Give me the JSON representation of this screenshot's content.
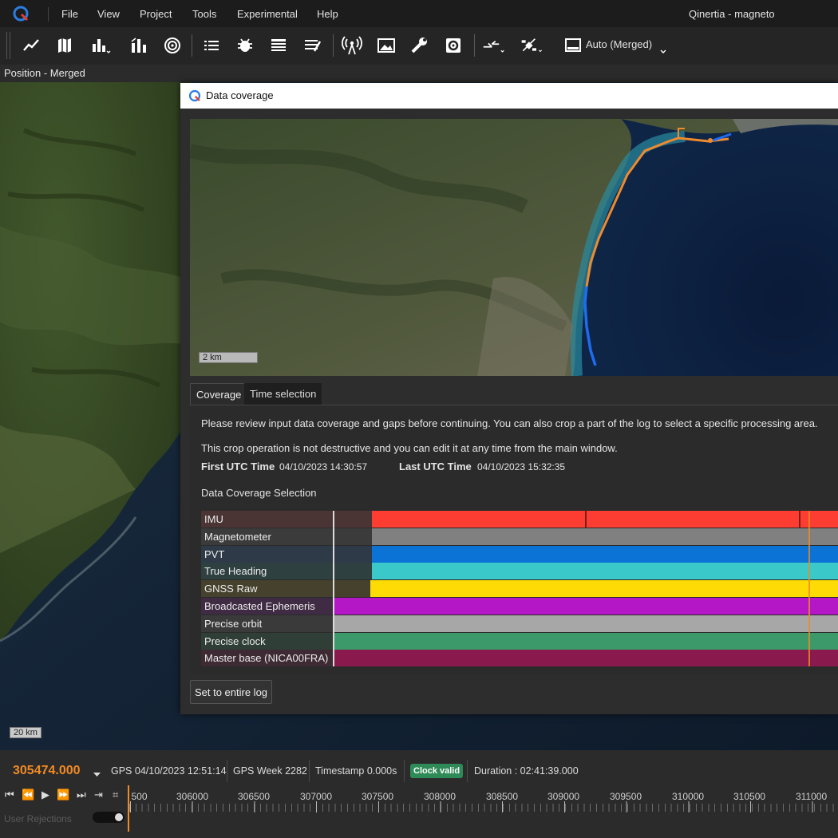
{
  "app": {
    "title": "Qinertia - magneto",
    "menu": [
      "File",
      "View",
      "Project",
      "Tools",
      "Experimental",
      "Help"
    ]
  },
  "toolbar": {
    "icons": [
      "line-chart-icon",
      "map-icon",
      "bar-chart-icon",
      "stacked-bars-icon",
      "target-icon",
      "list-icon",
      "bug-icon",
      "table-icon",
      "table-edit-icon",
      "antenna-icon",
      "image-icon",
      "wrench-icon",
      "settings-box-icon",
      "arrows-icon",
      "satellite-icon",
      "monitor-icon"
    ],
    "mode_label": "Auto (Merged)"
  },
  "position_bar": {
    "label": "Position - Merged"
  },
  "background_map": {
    "scale": "20 km"
  },
  "dialog": {
    "title": "Data coverage",
    "map_scale": "2 km",
    "tabs": [
      "Coverage",
      "Time selection"
    ],
    "intro_line1": "Please review input data coverage and gaps before continuing. You can also crop a part of the log to select a specific processing area.",
    "intro_line2": "This crop operation is not destructive and you can edit it at any time from the main window.",
    "first_utc_label": "First UTC Time",
    "first_utc_value": "04/10/2023 14:30:57",
    "last_utc_label": "Last UTC Time",
    "last_utc_value": "04/10/2023 15:32:35",
    "section_title": "Data Coverage Selection",
    "rows": [
      {
        "label": "IMU",
        "color": "#fe3d32",
        "label_bg": "#4a3434"
      },
      {
        "label": "Magnetometer",
        "color": "#808080",
        "label_bg": "#3b3b3b"
      },
      {
        "label": "PVT",
        "color": "#0b72d6",
        "label_bg": "#2e3a48"
      },
      {
        "label": "True Heading",
        "color": "#3ac8c8",
        "label_bg": "#2f4040"
      },
      {
        "label": "GNSS Raw",
        "color": "#fedb05",
        "label_bg": "#45412c"
      },
      {
        "label": "Broadcasted Ephemeris",
        "color": "#b317c6",
        "label_bg": "#3f2c44"
      },
      {
        "label": "Precise orbit",
        "color": "#a7a7a7",
        "label_bg": "#3a3a3a"
      },
      {
        "label": "Precise clock",
        "color": "#3c9a6a",
        "label_bg": "#2f3e36"
      },
      {
        "label": "Master base (NICA00FRA)",
        "color": "#8a1a4e",
        "label_bg": "#3e2a33"
      }
    ],
    "set_button": "Set to entire log"
  },
  "status": {
    "gps_tow": "305474.000",
    "gps_date": "GPS 04/10/2023 12:51:14",
    "gps_week": "GPS Week 2282",
    "timestamp": "Timestamp 0.000s",
    "clock_badge": "Clock valid",
    "duration": "Duration : 02:41:39.000",
    "timeline_ticks": [
      "500",
      "306000",
      "306500",
      "307000",
      "307500",
      "308000",
      "308500",
      "309000",
      "309500",
      "310000",
      "310500",
      "311000"
    ],
    "user_rejections": "User Rejections"
  }
}
